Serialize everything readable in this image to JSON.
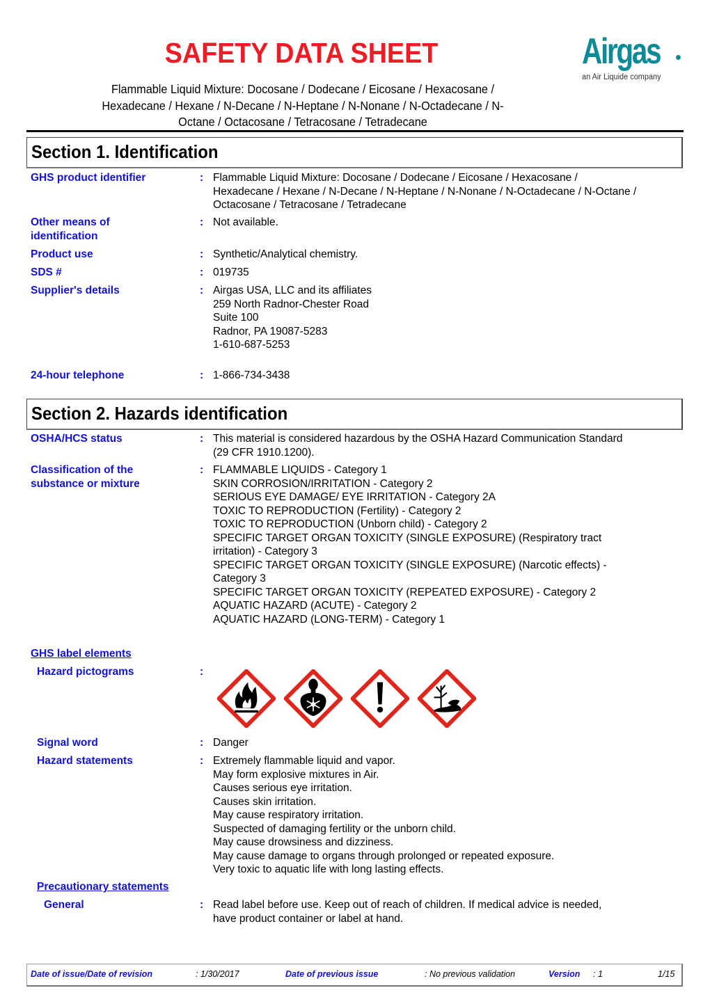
{
  "header": {
    "title": "SAFETY DATA SHEET",
    "subtitle_lines": [
      "Flammable Liquid Mixture:  Docosane / Dodecane / Eicosane / Hexacosane /",
      "Hexadecane / Hexane / N-Decane / N-Heptane / N-Nonane / N-Octadecane / N-",
      "Octane / Octacosane / Tetracosane / Tetradecane"
    ],
    "logo": {
      "name": "Airgas",
      "tagline": "an Air Liquide company",
      "color": "#0d8a98"
    }
  },
  "section1": {
    "title": "Section 1. Identification",
    "fields": {
      "ghs_product_identifier": {
        "label": "GHS product identifier",
        "lines": [
          "Flammable Liquid Mixture:  Docosane / Dodecane / Eicosane / Hexacosane /",
          "Hexadecane / Hexane / N-Decane / N-Heptane / N-Nonane / N-Octadecane / N-Octane /",
          "Octacosane / Tetracosane / Tetradecane"
        ]
      },
      "other_means": {
        "label_lines": [
          "Other means of",
          "identification"
        ],
        "value": "Not available."
      },
      "product_use": {
        "label": "Product use",
        "value": "Synthetic/Analytical chemistry."
      },
      "sds_number": {
        "label": "SDS #",
        "value": "019735"
      },
      "supplier": {
        "label": "Supplier's details",
        "lines": [
          "Airgas USA, LLC and its affiliates",
          "259 North Radnor-Chester Road",
          "Suite 100",
          "Radnor, PA 19087-5283",
          "1-610-687-5253"
        ]
      },
      "telephone_24h": {
        "label": "24-hour telephone",
        "value": "1-866-734-3438"
      }
    }
  },
  "section2": {
    "title": "Section 2. Hazards identification",
    "osha_status": {
      "label": "OSHA/HCS status",
      "lines": [
        "This material is considered hazardous by the OSHA Hazard Communication Standard",
        "(29 CFR 1910.1200)."
      ]
    },
    "classification": {
      "label_lines": [
        "Classification of the",
        "substance or mixture"
      ],
      "lines": [
        "FLAMMABLE LIQUIDS - Category 1",
        "SKIN CORROSION/IRRITATION - Category 2",
        "SERIOUS EYE DAMAGE/ EYE IRRITATION - Category 2A",
        "TOXIC TO REPRODUCTION (Fertility) - Category 2",
        "TOXIC TO REPRODUCTION (Unborn child) - Category 2",
        "SPECIFIC TARGET ORGAN TOXICITY (SINGLE EXPOSURE) (Respiratory tract",
        "irritation) - Category 3",
        "SPECIFIC TARGET ORGAN TOXICITY (SINGLE EXPOSURE) (Narcotic effects) -",
        "Category 3",
        "SPECIFIC TARGET ORGAN TOXICITY (REPEATED EXPOSURE) - Category 2",
        "AQUATIC HAZARD (ACUTE) - Category 2",
        "AQUATIC HAZARD (LONG-TERM) - Category 1"
      ]
    },
    "ghs_label_elements": {
      "label": "GHS label elements"
    },
    "hazard_pictograms": {
      "label": "Hazard pictograms",
      "icons": [
        "flame-icon",
        "health-hazard-icon",
        "exclamation-mark-icon",
        "environment-icon"
      ]
    },
    "signal_word": {
      "label": "Signal word",
      "value": "Danger"
    },
    "hazard_statements": {
      "label": "Hazard statements",
      "lines": [
        "Extremely flammable liquid and vapor.",
        "May form explosive mixtures in Air.",
        "Causes serious eye irritation.",
        "Causes skin irritation.",
        "May cause respiratory irritation.",
        "Suspected of damaging fertility or the unborn child.",
        "May cause drowsiness and dizziness.",
        "May cause damage to organs through prolonged or repeated exposure.",
        "Very toxic to aquatic life with long lasting effects."
      ]
    },
    "precautionary_statements": {
      "label": "Precautionary statements"
    },
    "general": {
      "label": "General",
      "lines": [
        "Read label before use.  Keep out of reach of children.  If medical advice is needed,",
        "have product container or label at hand."
      ]
    }
  },
  "footer": {
    "issue_label": "Date of issue/Date of revision",
    "issue_value": ": 1/30/2017",
    "previous_label": "Date of previous issue",
    "previous_value": ": No previous validation",
    "version_label": "Version",
    "version_value": ": 1",
    "page": "1/15"
  },
  "colors": {
    "title_red": "#ee1c25",
    "label_blue": "#1212d8",
    "pictogram_red": "#e0261c"
  }
}
